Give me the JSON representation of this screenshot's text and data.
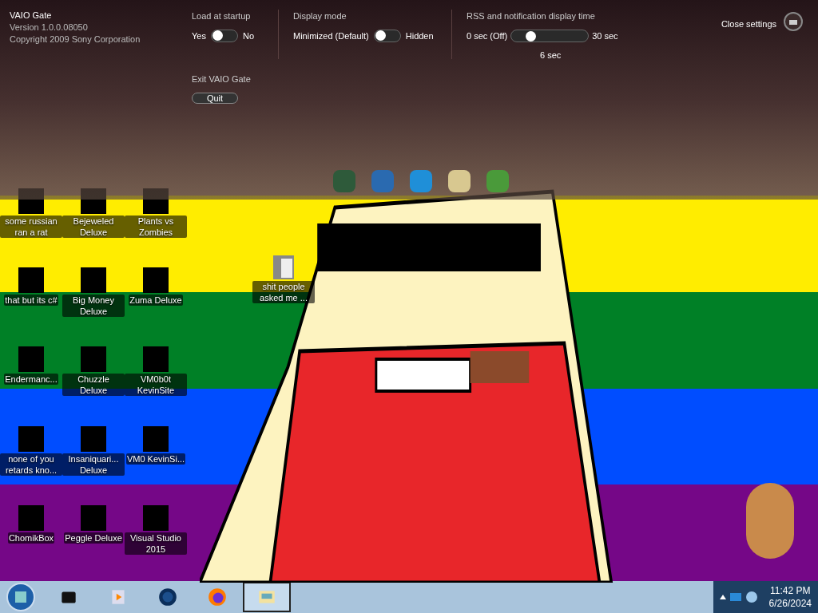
{
  "vaio_gate": {
    "title": "VAIO Gate",
    "version": "Version 1.0.0.08050",
    "copyright": "Copyright 2009 Sony Corporation",
    "toggles": [
      {
        "label": "Load at startup",
        "left": "Yes",
        "right": "No",
        "on": false
      },
      {
        "label": "Display mode",
        "left": "Minimized (Default)",
        "right": "Hidden",
        "on": false
      }
    ],
    "slider": {
      "label": "RSS and notification display time",
      "min_label": "0 sec (Off)",
      "max_label": "30 sec",
      "value_label": "6 sec",
      "level": 0.2
    },
    "exit": {
      "label": "Exit VAIO Gate",
      "button": "Quit"
    },
    "close_settings": "Close settings"
  },
  "desktop_icons": [
    [
      {
        "label": "some russian ran a rat"
      },
      {
        "label": "that but its c#"
      },
      {
        "label": "Endermanc..."
      },
      {
        "label": "none of you retards kno..."
      },
      {
        "label": "ChomikBox"
      }
    ],
    [
      {
        "label": "Bejeweled Deluxe"
      },
      {
        "label": "Big Money Deluxe"
      },
      {
        "label": "Chuzzle Deluxe"
      },
      {
        "label": "Insaniquari... Deluxe"
      },
      {
        "label": "Peggle Deluxe"
      }
    ],
    [
      {
        "label": "Plants vs Zombies"
      },
      {
        "label": "Zuma Deluxe"
      },
      {
        "label": "VM0b0t KevinSite"
      },
      {
        "label": "VM0 KevinSi..."
      },
      {
        "label": "Visual Studio 2015"
      }
    ]
  ],
  "loose_icon": {
    "label": "shit people asked me ..."
  },
  "taskbar": {
    "items": [
      {
        "selected": false
      },
      {
        "selected": false
      },
      {
        "selected": false
      },
      {
        "selected": false
      },
      {
        "selected": true
      }
    ],
    "time": "11:42 PM",
    "date": "6/26/2024"
  }
}
